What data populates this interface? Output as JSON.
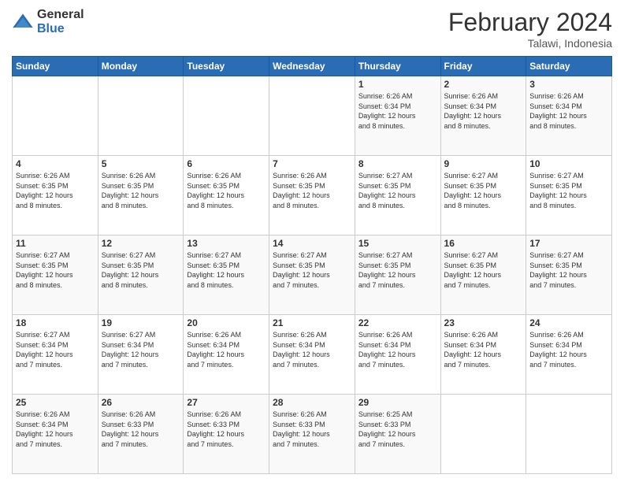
{
  "logo": {
    "general": "General",
    "blue": "Blue"
  },
  "header": {
    "title": "February 2024",
    "subtitle": "Talawi, Indonesia"
  },
  "days_of_week": [
    "Sunday",
    "Monday",
    "Tuesday",
    "Wednesday",
    "Thursday",
    "Friday",
    "Saturday"
  ],
  "weeks": [
    [
      {
        "num": "",
        "info": ""
      },
      {
        "num": "",
        "info": ""
      },
      {
        "num": "",
        "info": ""
      },
      {
        "num": "",
        "info": ""
      },
      {
        "num": "1",
        "info": "Sunrise: 6:26 AM\nSunset: 6:34 PM\nDaylight: 12 hours\nand 8 minutes."
      },
      {
        "num": "2",
        "info": "Sunrise: 6:26 AM\nSunset: 6:34 PM\nDaylight: 12 hours\nand 8 minutes."
      },
      {
        "num": "3",
        "info": "Sunrise: 6:26 AM\nSunset: 6:34 PM\nDaylight: 12 hours\nand 8 minutes."
      }
    ],
    [
      {
        "num": "4",
        "info": "Sunrise: 6:26 AM\nSunset: 6:35 PM\nDaylight: 12 hours\nand 8 minutes."
      },
      {
        "num": "5",
        "info": "Sunrise: 6:26 AM\nSunset: 6:35 PM\nDaylight: 12 hours\nand 8 minutes."
      },
      {
        "num": "6",
        "info": "Sunrise: 6:26 AM\nSunset: 6:35 PM\nDaylight: 12 hours\nand 8 minutes."
      },
      {
        "num": "7",
        "info": "Sunrise: 6:26 AM\nSunset: 6:35 PM\nDaylight: 12 hours\nand 8 minutes."
      },
      {
        "num": "8",
        "info": "Sunrise: 6:27 AM\nSunset: 6:35 PM\nDaylight: 12 hours\nand 8 minutes."
      },
      {
        "num": "9",
        "info": "Sunrise: 6:27 AM\nSunset: 6:35 PM\nDaylight: 12 hours\nand 8 minutes."
      },
      {
        "num": "10",
        "info": "Sunrise: 6:27 AM\nSunset: 6:35 PM\nDaylight: 12 hours\nand 8 minutes."
      }
    ],
    [
      {
        "num": "11",
        "info": "Sunrise: 6:27 AM\nSunset: 6:35 PM\nDaylight: 12 hours\nand 8 minutes."
      },
      {
        "num": "12",
        "info": "Sunrise: 6:27 AM\nSunset: 6:35 PM\nDaylight: 12 hours\nand 8 minutes."
      },
      {
        "num": "13",
        "info": "Sunrise: 6:27 AM\nSunset: 6:35 PM\nDaylight: 12 hours\nand 8 minutes."
      },
      {
        "num": "14",
        "info": "Sunrise: 6:27 AM\nSunset: 6:35 PM\nDaylight: 12 hours\nand 7 minutes."
      },
      {
        "num": "15",
        "info": "Sunrise: 6:27 AM\nSunset: 6:35 PM\nDaylight: 12 hours\nand 7 minutes."
      },
      {
        "num": "16",
        "info": "Sunrise: 6:27 AM\nSunset: 6:35 PM\nDaylight: 12 hours\nand 7 minutes."
      },
      {
        "num": "17",
        "info": "Sunrise: 6:27 AM\nSunset: 6:35 PM\nDaylight: 12 hours\nand 7 minutes."
      }
    ],
    [
      {
        "num": "18",
        "info": "Sunrise: 6:27 AM\nSunset: 6:34 PM\nDaylight: 12 hours\nand 7 minutes."
      },
      {
        "num": "19",
        "info": "Sunrise: 6:27 AM\nSunset: 6:34 PM\nDaylight: 12 hours\nand 7 minutes."
      },
      {
        "num": "20",
        "info": "Sunrise: 6:26 AM\nSunset: 6:34 PM\nDaylight: 12 hours\nand 7 minutes."
      },
      {
        "num": "21",
        "info": "Sunrise: 6:26 AM\nSunset: 6:34 PM\nDaylight: 12 hours\nand 7 minutes."
      },
      {
        "num": "22",
        "info": "Sunrise: 6:26 AM\nSunset: 6:34 PM\nDaylight: 12 hours\nand 7 minutes."
      },
      {
        "num": "23",
        "info": "Sunrise: 6:26 AM\nSunset: 6:34 PM\nDaylight: 12 hours\nand 7 minutes."
      },
      {
        "num": "24",
        "info": "Sunrise: 6:26 AM\nSunset: 6:34 PM\nDaylight: 12 hours\nand 7 minutes."
      }
    ],
    [
      {
        "num": "25",
        "info": "Sunrise: 6:26 AM\nSunset: 6:34 PM\nDaylight: 12 hours\nand 7 minutes."
      },
      {
        "num": "26",
        "info": "Sunrise: 6:26 AM\nSunset: 6:33 PM\nDaylight: 12 hours\nand 7 minutes."
      },
      {
        "num": "27",
        "info": "Sunrise: 6:26 AM\nSunset: 6:33 PM\nDaylight: 12 hours\nand 7 minutes."
      },
      {
        "num": "28",
        "info": "Sunrise: 6:26 AM\nSunset: 6:33 PM\nDaylight: 12 hours\nand 7 minutes."
      },
      {
        "num": "29",
        "info": "Sunrise: 6:25 AM\nSunset: 6:33 PM\nDaylight: 12 hours\nand 7 minutes."
      },
      {
        "num": "",
        "info": ""
      },
      {
        "num": "",
        "info": ""
      }
    ]
  ]
}
